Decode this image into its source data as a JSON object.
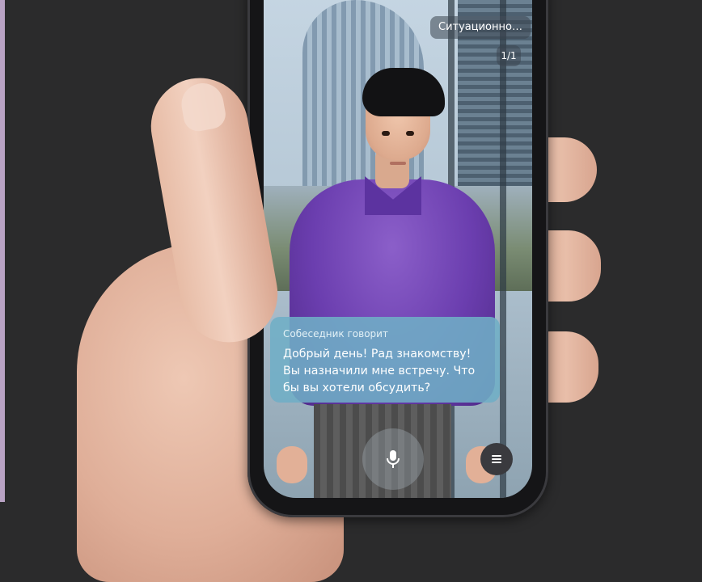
{
  "scenario": {
    "label": "Ситуационно…",
    "counter": "1/1"
  },
  "speech": {
    "label": "Собеседник говорит",
    "text": "Добрый день! Рад знакомству! Вы назначили мне встречу. Что бы вы хотели обсудить?"
  },
  "controls": {
    "mic_icon": "microphone-icon",
    "menu_icon": "menu-icon"
  },
  "colors": {
    "shirt": "#6b3eaf",
    "bubble": "#70aec6",
    "background": "#2b2b2c"
  }
}
